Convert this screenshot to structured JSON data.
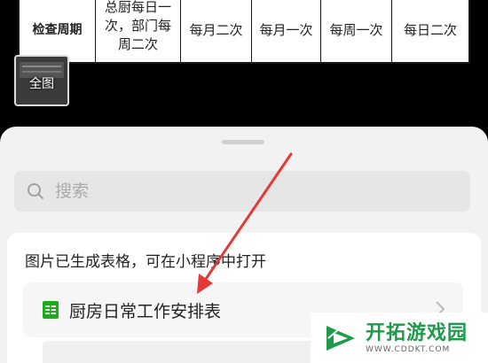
{
  "viewer": {
    "table_row": {
      "header": "检查周期",
      "col1_lines": [
        "总厨每日一",
        "次，部门每",
        "周二次"
      ],
      "col2": "每月二次",
      "col3": "每月一次",
      "col4": "每周一次",
      "col5": "每日二次"
    },
    "thumbnail_label": "全图"
  },
  "sheet": {
    "search": {
      "placeholder": "搜索",
      "icon": "search-icon"
    },
    "result_card": {
      "hint": "图片已生成表格，可在小程序中打开",
      "file": {
        "name": "厨房日常工作安排表",
        "icon": "spreadsheet-icon",
        "accent": "#1aad19"
      }
    }
  },
  "annotation": {
    "arrow_color": "#e53935"
  },
  "watermark": {
    "brand": "开拓游戏园",
    "url": "WWW.CDDKT.COM",
    "color": "#1f9a4a"
  }
}
